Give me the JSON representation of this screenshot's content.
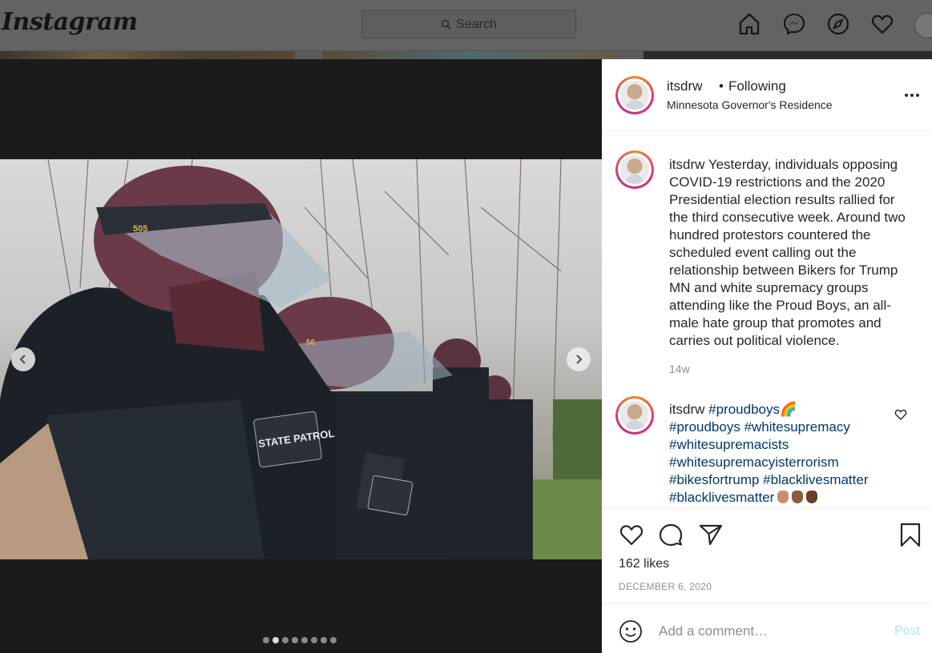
{
  "topbar": {
    "logo": "Instagram",
    "search_placeholder": "Search",
    "nav_icons": [
      "home-icon",
      "messenger-icon",
      "explore-icon",
      "activity-heart-icon",
      "profile-avatar"
    ]
  },
  "carousel": {
    "slide_count": 8,
    "active_index": 1,
    "patch_labels": [
      "STATE PATROL",
      "STATE PATROL"
    ],
    "helmet_numbers": [
      "505",
      "56"
    ]
  },
  "post": {
    "author": "itsdrw",
    "separator": "•",
    "follow_status": "Following",
    "location": "Minnesota Governor's Residence",
    "caption_author": "itsdrw",
    "caption": "Yesterday, individuals opposing COVID-19 restrictions and the 2020 Presidential election results rallied for the third consecutive week. Around two hundred protestors countered the scheduled event calling out the relationship between Bikers for Trump MN and white supremacy groups attending like the Proud Boys, an all-male hate group that promotes and carries out political violence.",
    "caption_age": "14w",
    "comment": {
      "author": "itsdrw",
      "tags": [
        "#proudboys",
        "#proudboys",
        "#whitesupremacy",
        "#whitesupremacists",
        "#whitesupremacyisterrorism",
        "#bikesfortrump",
        "#blacklivesmatter",
        "#blacklivesmatter"
      ],
      "emoji_after_first": "🌈"
    },
    "likes": "162 likes",
    "date": "DECEMBER 6, 2020",
    "add_comment_placeholder": "Add a comment…",
    "post_button": "Post"
  },
  "colors": {
    "link_blue": "#00376b",
    "post_button": "#b2dffc",
    "text": "#262626",
    "muted": "#8e8e8e"
  }
}
